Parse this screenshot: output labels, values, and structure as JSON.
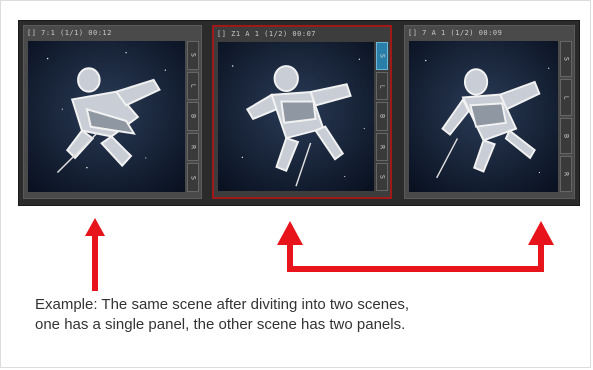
{
  "panels": [
    {
      "header": "[] 7:1 (1/1) 00:12",
      "tabs": [
        "S",
        "L",
        "B",
        "R",
        "S"
      ]
    },
    {
      "header": "[] Z1 A 1 (1/2) 00:07",
      "tabs": [
        "S",
        "L",
        "B",
        "R",
        "S"
      ]
    },
    {
      "header": "[] 7 A 1 (1/2) 00:09",
      "tabs": [
        "S",
        "L",
        "B",
        "R"
      ]
    }
  ],
  "caption": {
    "line1": "Example: The same scene after diviting into two scenes,",
    "line2": "one has a single panel, the other scene has two panels."
  },
  "colors": {
    "arrow": "#e8141c",
    "selected_border": "#a01818",
    "strip_bg": "#2b2b2b"
  }
}
